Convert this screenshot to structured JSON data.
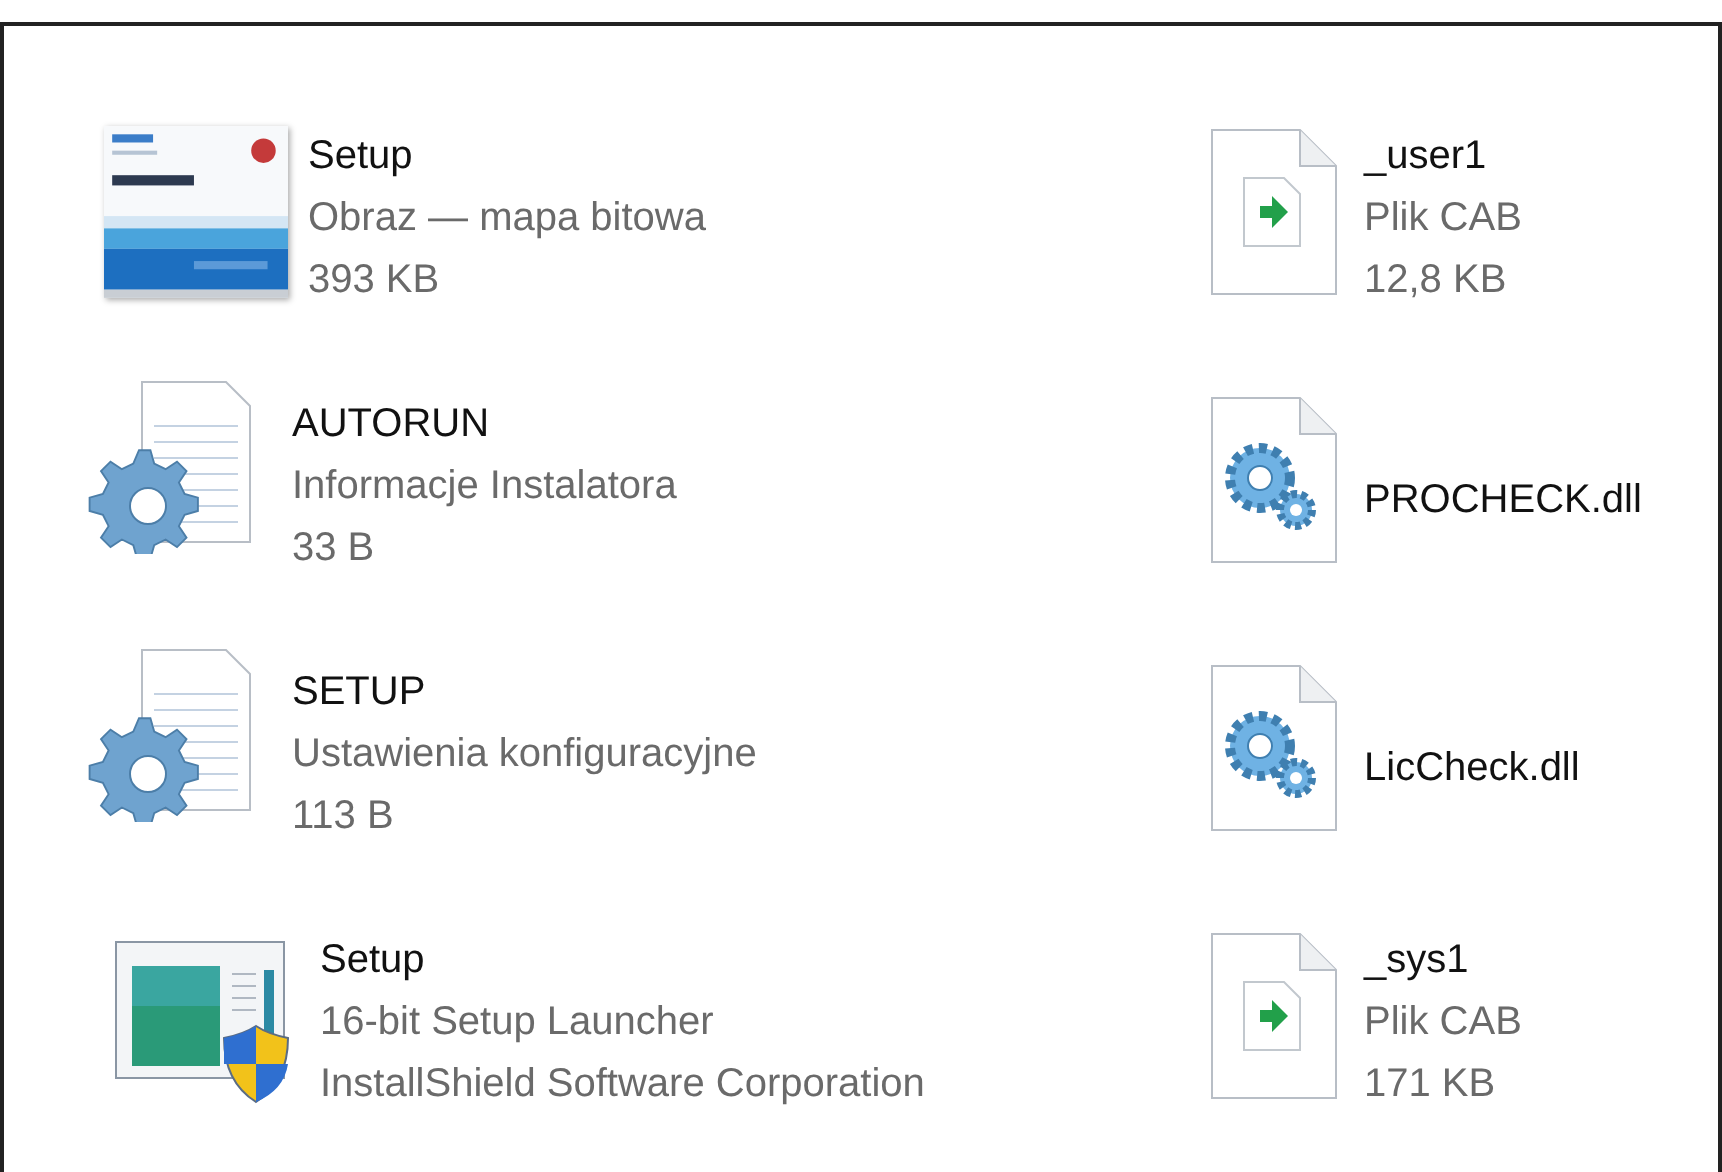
{
  "items": [
    {
      "kind": "bitmap",
      "name": "Setup",
      "details": [
        "Obraz — mapa bitowa",
        "393 KB"
      ]
    },
    {
      "kind": "cab",
      "name": "_user1",
      "details": [
        "Plik CAB",
        "12,8 KB"
      ]
    },
    {
      "kind": "ini",
      "name": "AUTORUN",
      "details": [
        "Informacje Instalatora",
        "33 B"
      ]
    },
    {
      "kind": "dll",
      "name": "PROCHECK.dll"
    },
    {
      "kind": "ini",
      "name": "SETUP",
      "details": [
        "Ustawienia konfiguracyjne",
        "113 B"
      ]
    },
    {
      "kind": "dll",
      "name": "LicCheck.dll"
    },
    {
      "kind": "exe",
      "name": "Setup",
      "details": [
        "16-bit Setup Launcher",
        "InstallShield Software Corporation"
      ]
    },
    {
      "kind": "cab",
      "name": "_sys1",
      "details": [
        "Plik CAB",
        "171 KB"
      ]
    }
  ]
}
